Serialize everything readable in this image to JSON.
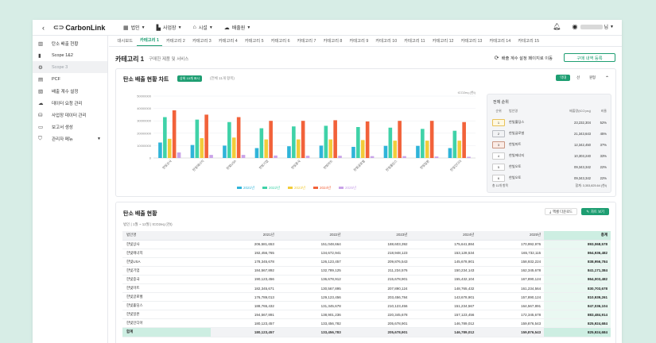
{
  "header": {
    "logo": "CarbonLink",
    "nav": [
      {
        "label": "법인",
        "icon": "building-icon"
      },
      {
        "label": "사업장",
        "icon": "factory-icon"
      },
      {
        "label": "시설",
        "icon": "facility-icon"
      },
      {
        "label": "배출원",
        "icon": "source-icon"
      }
    ],
    "user_suffix": "님"
  },
  "sidebar": {
    "items": [
      {
        "label": "탄소 배출 현황",
        "icon": "dashboard-icon"
      },
      {
        "label": "Scope 1&2",
        "icon": "chart-icon"
      },
      {
        "label": "Scope 3",
        "icon": "scope3-icon"
      },
      {
        "label": "PCF",
        "icon": "pcf-icon"
      },
      {
        "label": "배출 계수 설정",
        "icon": "coefficient-icon"
      },
      {
        "label": "데이터 요청 관리",
        "icon": "cloud-icon"
      },
      {
        "label": "사업장 데이터 관리",
        "icon": "data-icon"
      },
      {
        "label": "보고서 생성",
        "icon": "report-icon"
      },
      {
        "label": "관리자 메뉴",
        "icon": "shield-icon"
      }
    ]
  },
  "tabs": [
    "대시보드",
    "카테고리 1",
    "카테고리 2",
    "카테고리 3",
    "카테고리 4",
    "카테고리 5",
    "카테고리 6",
    "카테고리 7",
    "카테고리 8",
    "카테고리 9",
    "카테고리 10",
    "카테고리 11",
    "카테고리 12",
    "카테고리 13",
    "카테고리 14",
    "카테고리 15"
  ],
  "page": {
    "title": "카테고리 1",
    "subtitle": "구매한 제품 및 서비스",
    "link_label": "배출 계수 설정 페이지로 이동",
    "button_label": "구매 내역 등록"
  },
  "chart_card": {
    "title": "탄소 배출 현황 차트",
    "badge": "상위 10개 표시",
    "note": "(전체 11개 항목)",
    "controls": [
      "막대",
      "선",
      "원형"
    ]
  },
  "chart_data": {
    "type": "bar",
    "unit": "tCO2eq (천t)",
    "ylim": [
      0,
      50000000
    ],
    "yticks": [
      "0",
      "10000000",
      "20000000",
      "30000000",
      "40000000",
      "50000000"
    ],
    "categories": [
      "한빛상사",
      "한빛에너지",
      "한빛USA",
      "한빛기업",
      "한빛중국",
      "한빛마트",
      "한빛글로벌",
      "한빛홀딩스",
      "한빛일본",
      "한빛인디아"
    ],
    "series": [
      {
        "name": "2021년",
        "color": "#2fb4d9",
        "values": [
          12500000,
          10500000,
          10000000,
          8000000,
          9500000,
          10000000,
          9000000,
          9800000,
          9800000,
          8000000
        ]
      },
      {
        "name": "2022년",
        "color": "#3fd2a8",
        "values": [
          33000000,
          31000000,
          29000000,
          24000000,
          25500000,
          26000000,
          25000000,
          24500000,
          23500000,
          22000000
        ]
      },
      {
        "name": "2023년",
        "color": "#f2cc3a",
        "values": [
          15500000,
          16000000,
          16500000,
          15000000,
          15000000,
          15000000,
          14500000,
          14000000,
          14000000,
          14000000
        ]
      },
      {
        "name": "2024년",
        "color": "#f2623a",
        "values": [
          38500000,
          35000000,
          33000000,
          30000000,
          30000000,
          30500000,
          29500000,
          30000000,
          30000000,
          29000000
        ]
      },
      {
        "name": "2025년",
        "color": "#c9a3e8",
        "values": [
          4500000,
          2500000,
          2500000,
          2000000,
          1800000,
          1800000,
          1500000,
          1500000,
          1200000,
          1000000
        ]
      }
    ]
  },
  "ranking": {
    "title": "전체 순위",
    "headers": [
      "순위",
      "법인명",
      "배출량(tCO₂eq)",
      "비율"
    ],
    "rows": [
      {
        "rank": "1",
        "name": "한빛홀딩스",
        "value": "23,232,304",
        "pct": "52%"
      },
      {
        "rank": "2",
        "name": "한빛글로벌",
        "value": "21,343,643",
        "pct": "45%"
      },
      {
        "rank": "3",
        "name": "한빛마트",
        "value": "12,342,450",
        "pct": "37%"
      },
      {
        "rank": "4",
        "name": "한빛에너지",
        "value": "10,303,240",
        "pct": "33%"
      },
      {
        "rank": "5",
        "name": "한빛오토",
        "value": "09,343,342",
        "pct": "22%"
      },
      {
        "rank": "6",
        "name": "한빛오토",
        "value": "09,343,342",
        "pct": "22%"
      }
    ],
    "footer_left": "총 11개 항목",
    "footer_right": "합계: 3,353,825.64 (천t)"
  },
  "table_card": {
    "title": "탄소 배출 현황",
    "unit_label": "법인 | 1월 ~ 12월 | tCO2eq (천t)",
    "excel_label": "엑셀 다운로드",
    "save_label": "차트 보기",
    "headers": [
      "법인명",
      "2021년",
      "2022년",
      "2023년",
      "2024년",
      "2025년",
      "총계"
    ],
    "rows": [
      [
        "한빛상사",
        "206,581,653",
        "151,048,664",
        "188,603,392",
        "175,641,884",
        "170,992,976",
        "893,068,578"
      ],
      [
        "한빛에너지",
        "192,456,765",
        "134,672,941",
        "218,948,123",
        "153,128,534",
        "165,732,115",
        "864,936,482"
      ],
      [
        "한빛USA",
        "178,345,678",
        "126,123,457",
        "209,876,543",
        "145,678,901",
        "158,932,224",
        "838,956,784"
      ],
      [
        "한빛기업",
        "184,567,892",
        "132,789,125",
        "211,234,576",
        "150,234,143",
        "162,345,678",
        "841,171,384"
      ],
      [
        "한빛중국",
        "190,123,456",
        "136,678,912",
        "215,678,901",
        "155,432,104",
        "167,890,124",
        "864,003,482"
      ],
      [
        "한빛마트",
        "182,345,671",
        "130,567,895",
        "207,890,124",
        "148,765,432",
        "161,234,564",
        "830,703,678"
      ],
      [
        "한빛글로벌",
        "176,789,013",
        "129,123,456",
        "203,456,784",
        "143,678,901",
        "157,890,124",
        "810,939,261"
      ],
      [
        "한빛홀딩스",
        "188,765,432",
        "131,345,678",
        "210,123,456",
        "151,234,567",
        "164,567,891",
        "847,036,104"
      ],
      [
        "한빛일본",
        "194,567,891",
        "138,901,236",
        "220,345,678",
        "157,123,456",
        "172,345,678",
        "883,484,914"
      ],
      [
        "한빛인디아",
        "180,123,457",
        "133,456,782",
        "205,678,901",
        "146,789,012",
        "159,876,543",
        "825,924,684"
      ]
    ],
    "total_row": [
      "합계",
      "180,123,457",
      "133,456,783",
      "205,678,901",
      "146,789,012",
      "159,876,543",
      "825,924,684"
    ]
  }
}
